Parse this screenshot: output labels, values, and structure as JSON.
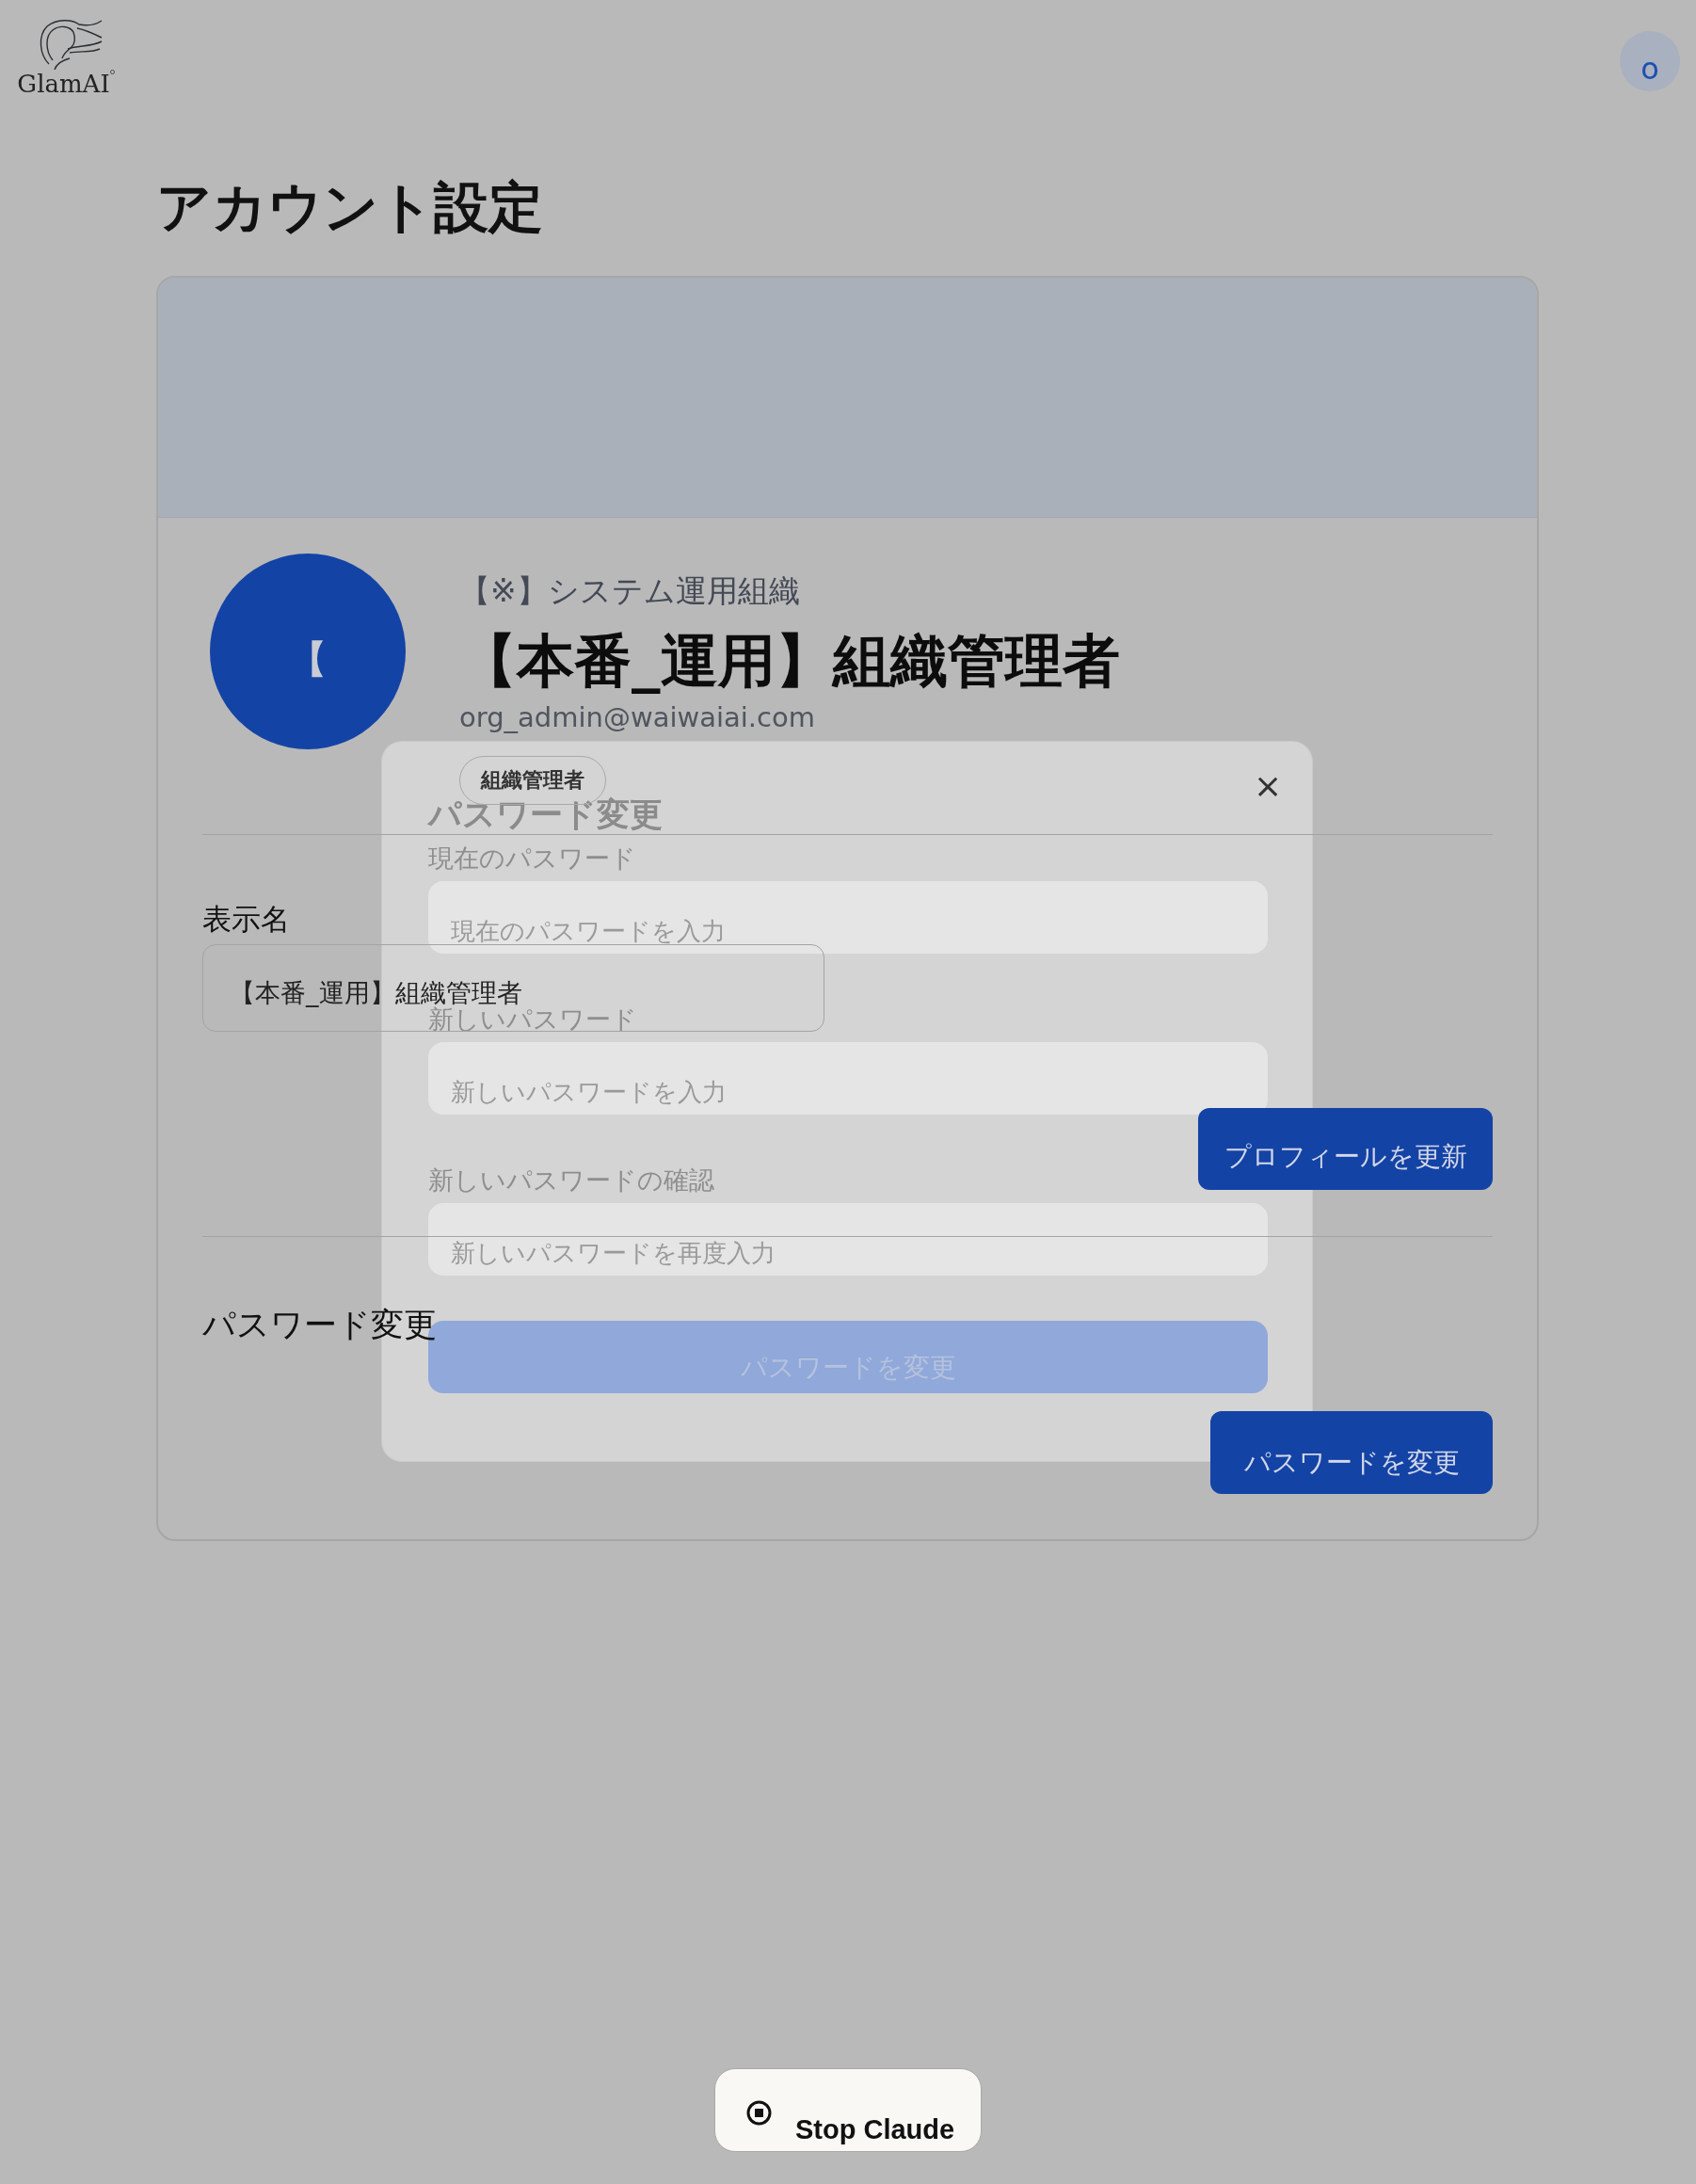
{
  "header": {
    "logo_text": "GlamAI",
    "avatar_initial": "o"
  },
  "page_title": "アカウント設定",
  "profile": {
    "avatar_initial": "【",
    "organization": "【※】システム運用組織",
    "name": "【本番_運用】組織管理者",
    "email": "org_admin@waiwaiai.com",
    "role_badge": "組織管理者"
  },
  "display_name": {
    "label": "表示名",
    "value": "【本番_運用】組織管理者",
    "button": "プロフィールを更新"
  },
  "password_section": {
    "heading": "パスワード変更",
    "button": "パスワードを変更"
  },
  "dialog": {
    "title": "パスワード変更",
    "close": "×",
    "fields": [
      {
        "label": "現在のパスワード",
        "placeholder": "現在のパスワードを入力"
      },
      {
        "label": "新しいパスワード",
        "placeholder": "新しいパスワードを入力"
      },
      {
        "label": "新しいパスワードの確認",
        "placeholder": "新しいパスワードを再度入力"
      }
    ],
    "submit": {
      "label": "パスワードを変更",
      "disabled": true
    }
  },
  "stop_button": {
    "label": "Stop Claude"
  }
}
